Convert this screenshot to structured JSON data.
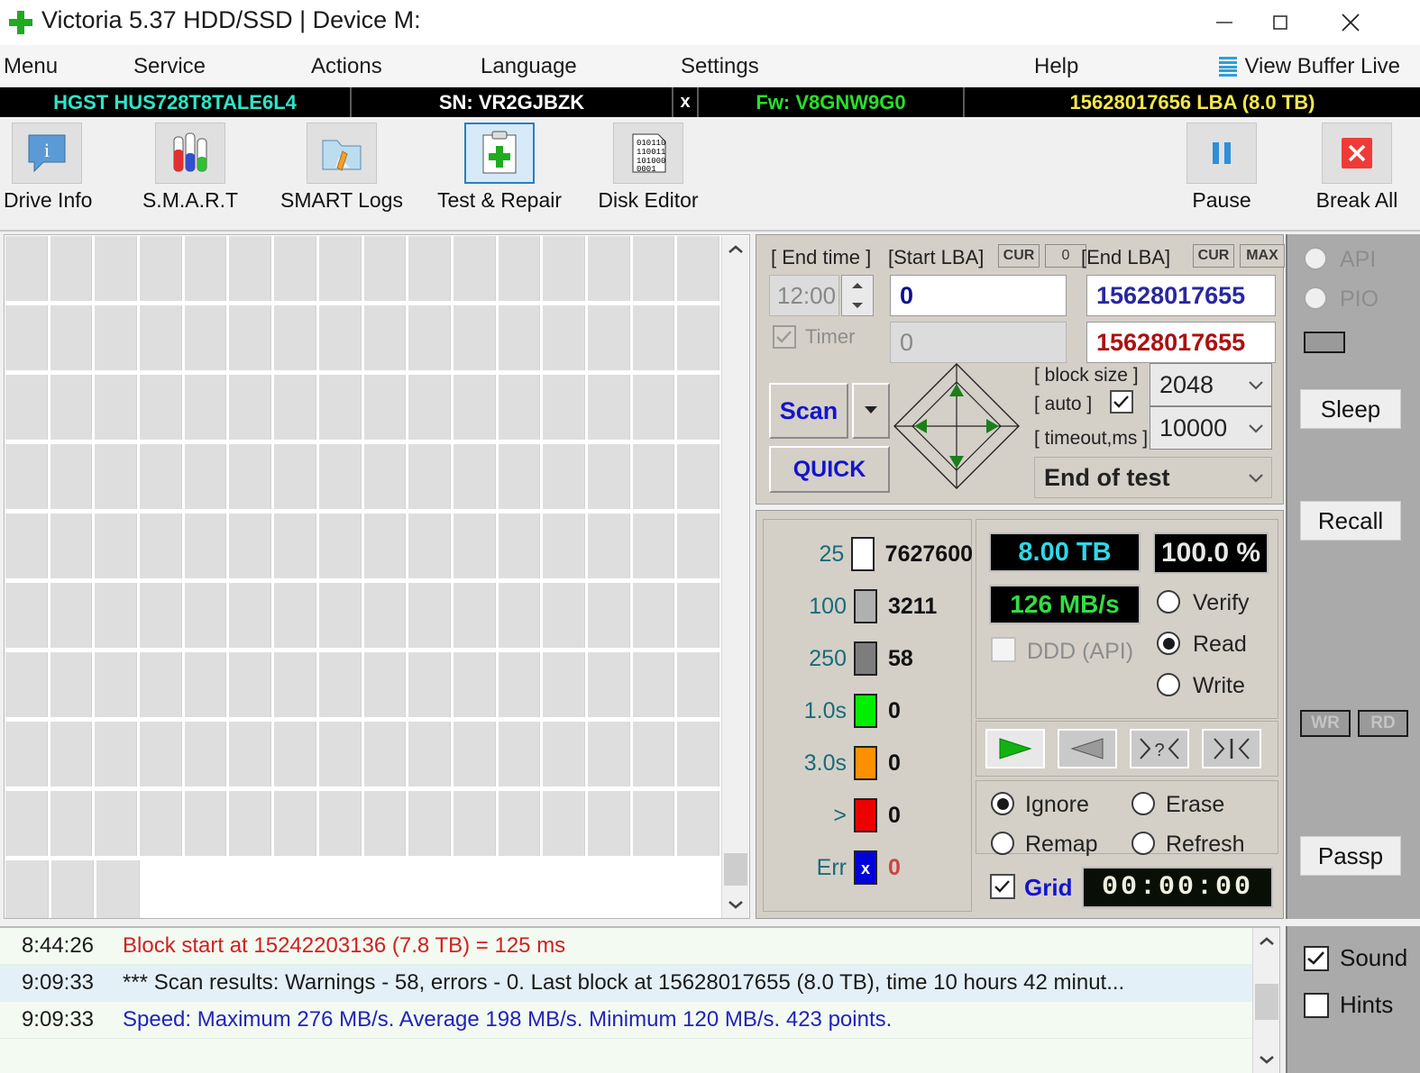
{
  "window": {
    "title": "Victoria 5.37 HDD/SSD | Device M:",
    "logo_icon": "green-cross-icon",
    "minimize_icon": "minimize-icon",
    "maximize_icon": "maximize-icon",
    "close_icon": "close-icon"
  },
  "menu": {
    "items": [
      "Menu",
      "Service",
      "Actions",
      "Language",
      "Settings",
      "Help"
    ],
    "view_buffer_live": "View Buffer Live",
    "view_buffer_icon": "list-lines-icon"
  },
  "drive": {
    "model": "HGST HUS728T8TALE6L4",
    "serial": "SN: VR2GJBZK",
    "close_drive": "x",
    "firmware": "Fw: V8GNW9G0",
    "capacity": "15628017656 LBA (8.0 TB)",
    "color_model": "#2ee6c8",
    "color_fw": "#27e02a",
    "color_lba": "#f2e84a"
  },
  "toolbar": {
    "buttons": [
      {
        "label": "Drive Info",
        "icon": "info-bubble-icon",
        "selected": false
      },
      {
        "label": "S.M.A.R.T",
        "icon": "test-tubes-icon",
        "selected": false
      },
      {
        "label": "SMART Logs",
        "icon": "folder-pencil-icon",
        "selected": false
      },
      {
        "label": "Test & Repair",
        "icon": "clipboard-cross-icon",
        "selected": true
      },
      {
        "label": "Disk Editor",
        "icon": "binary-page-icon",
        "selected": false
      }
    ],
    "pause": {
      "label": "Pause",
      "icon": "pause-icon"
    },
    "break_all": {
      "label": "Break All",
      "icon": "red-x-icon"
    }
  },
  "scan_setup": {
    "end_time_label": "[ End time ]",
    "end_time_value": "12:00",
    "timer_label": "Timer",
    "timer_checked": true,
    "timer_value": "0",
    "start_lba_label": "[Start LBA]",
    "start_lba_cur": "CUR",
    "start_lba_zero": "0",
    "start_lba_value": "0",
    "end_lba_label": "[End LBA]",
    "end_lba_cur": "CUR",
    "end_lba_max": "MAX",
    "end_lba_value": "15628017655",
    "end_lba_value2": "15628017655",
    "scan_button": "Scan",
    "scan_dropdown_icon": "caret-down-icon",
    "quick_button": "QUICK",
    "dpad_icon": "dpad-diamond-icon",
    "block_size_label": "[ block size ]",
    "auto_label": "[ auto ]",
    "auto_checked": true,
    "block_size_value": "2048",
    "timeout_label": "[ timeout,ms ]",
    "timeout_value": "10000",
    "end_of_test_value": "End of test"
  },
  "legend": {
    "rows": [
      {
        "time": "25",
        "color": "#ffffff",
        "count": "7627600"
      },
      {
        "time": "100",
        "color": "#b0b0b0",
        "count": "3211"
      },
      {
        "time": "250",
        "color": "#7d7d7d",
        "count": "58"
      },
      {
        "time": "1.0s",
        "color": "#00ee00",
        "count": "0"
      },
      {
        "time": "3.0s",
        "color": "#ff9000",
        "count": "0"
      },
      {
        "time": ">",
        "color": "#ee0000",
        "count": "0"
      },
      {
        "time": "Err",
        "color": "#0000dd",
        "count": "0",
        "glyph": "x-mark-icon",
        "count_color": "#cc4444"
      }
    ]
  },
  "stats": {
    "capacity_lcd": "8.00 TB",
    "capacity_color": "#2fd8e8",
    "percent_lcd": "100.0 %",
    "percent_color": "#e8e8e8",
    "speed_lcd": "126 MB/s",
    "speed_color": "#33dd44",
    "ddd_label": "DDD (API)",
    "ddd_checked": false,
    "modes": [
      {
        "label": "Verify",
        "selected": false
      },
      {
        "label": "Read",
        "selected": true
      },
      {
        "label": "Write",
        "selected": false
      }
    ]
  },
  "transport": {
    "buttons": [
      {
        "icon": "play-forward-icon",
        "active": true
      },
      {
        "icon": "play-backward-icon",
        "active": false
      },
      {
        "icon": "find-question-icon",
        "active": false
      },
      {
        "icon": "jump-to-icon",
        "active": false
      }
    ]
  },
  "defect_actions": {
    "options": [
      {
        "label": "Ignore",
        "selected": true
      },
      {
        "label": "Erase",
        "selected": false
      },
      {
        "label": "Remap",
        "selected": false
      },
      {
        "label": "Refresh",
        "selected": false
      }
    ]
  },
  "grid_row": {
    "grid_label": "Grid",
    "grid_checked": true,
    "timer_display": "00:00:00"
  },
  "sidebar": {
    "api_label": "API",
    "api_selected": false,
    "pio_label": "PIO",
    "pio_selected": false,
    "status_box": "",
    "sleep_button": "Sleep",
    "recall_button": "Recall",
    "wr_button": "WR",
    "rd_button": "RD",
    "passp_button": "Passp"
  },
  "log": {
    "rows": [
      {
        "time": "8:44:26",
        "message": "Block start at 15242203136 (7.8 TB)  = 125 ms",
        "color": "#d21f1f",
        "highlight": false
      },
      {
        "time": "9:09:33",
        "message": "*** Scan results: Warnings - 58, errors - 0. Last block at 15628017655 (8.0 TB), time 10 hours 42 minut...",
        "color": "#1a1a1a",
        "highlight": true
      },
      {
        "time": "9:09:33",
        "message": "Speed: Maximum 276 MB/s. Average 198 MB/s. Minimum 120 MB/s. 423 points.",
        "color": "#2222bb",
        "highlight": false
      }
    ],
    "scroll_up_icon": "chevron-up-icon",
    "scroll_down_icon": "chevron-down-icon"
  },
  "options": {
    "sound_label": "Sound",
    "sound_checked": true,
    "hints_label": "Hints",
    "hints_checked": false
  }
}
